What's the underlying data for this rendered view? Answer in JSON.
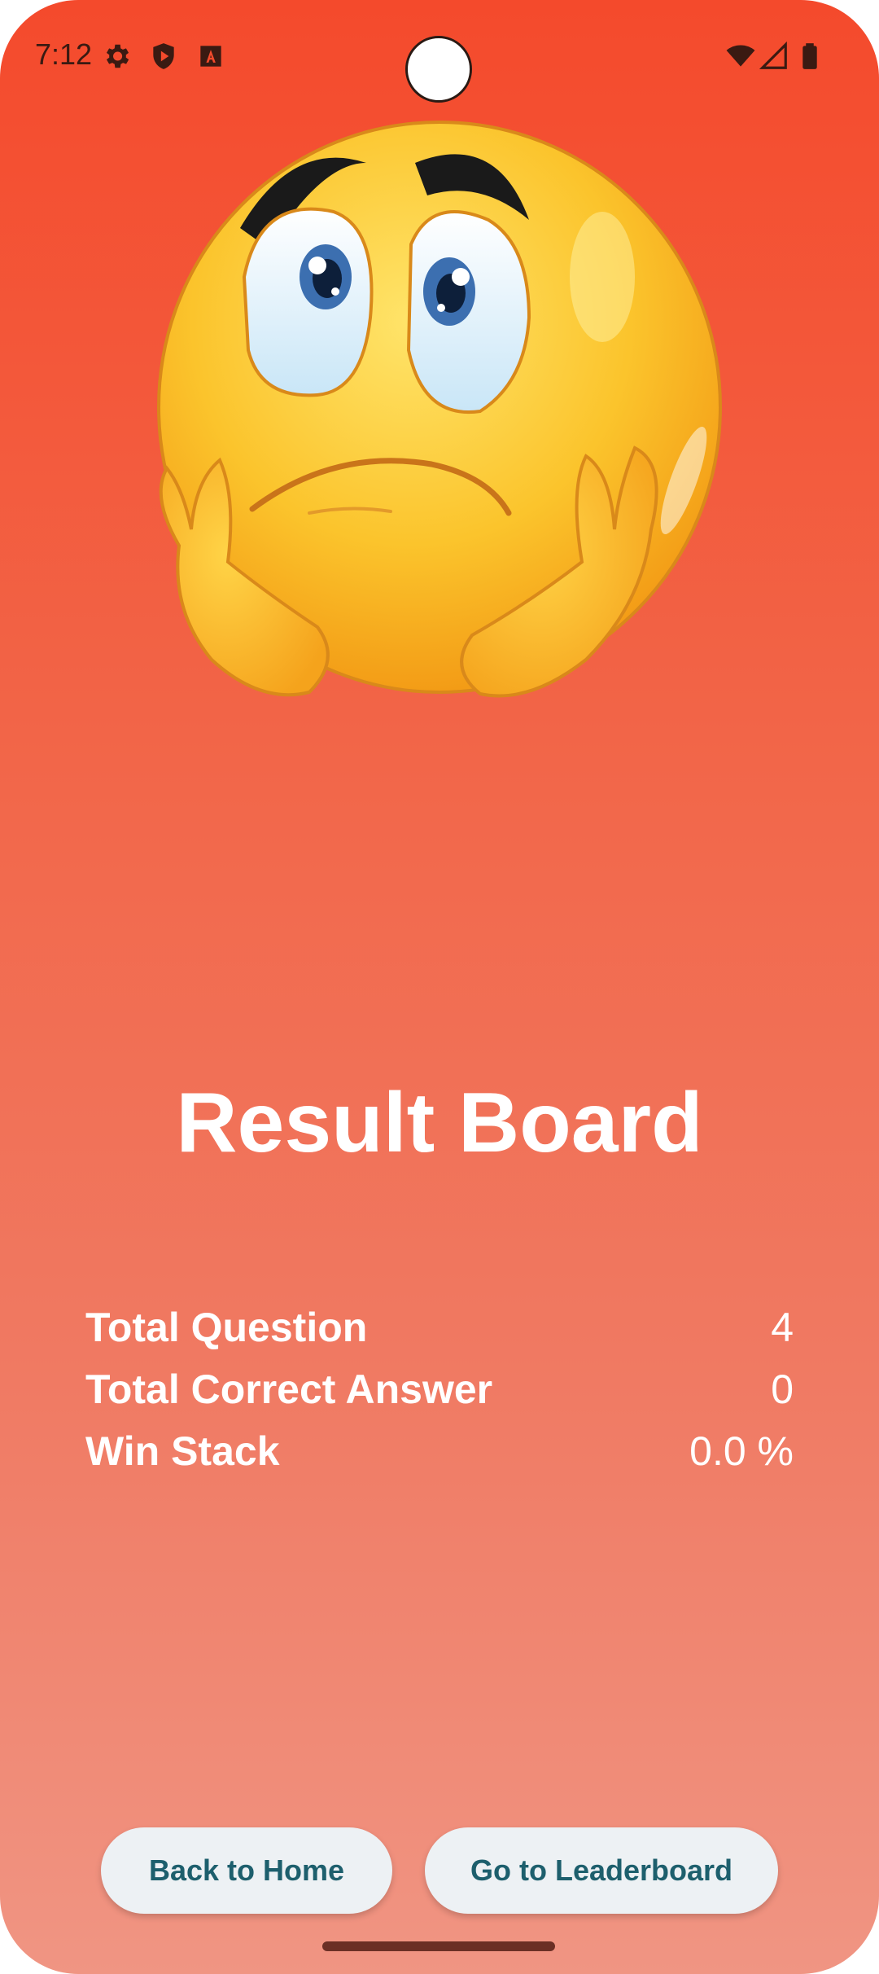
{
  "status_bar": {
    "time": "7:12",
    "left_icons": [
      "gear-icon",
      "shield-play-icon",
      "font-a-icon"
    ],
    "right_icons": [
      "wifi-icon",
      "signal-icon",
      "battery-icon"
    ]
  },
  "hero": {
    "icon": "sad-emoji-icon"
  },
  "result": {
    "title": "Result Board",
    "stats": [
      {
        "label": "Total Question",
        "value": "4"
      },
      {
        "label": "Total Correct Answer",
        "value": "0"
      },
      {
        "label": "Win Stack",
        "value": "0.0 %"
      }
    ]
  },
  "actions": {
    "home_label": "Back to Home",
    "leaderboard_label": "Go to Leaderboard"
  },
  "colors": {
    "background_top": "#f44a2c",
    "background_bottom": "#f09583",
    "button_bg": "#edf1f4",
    "button_text": "#1d5f6d"
  }
}
